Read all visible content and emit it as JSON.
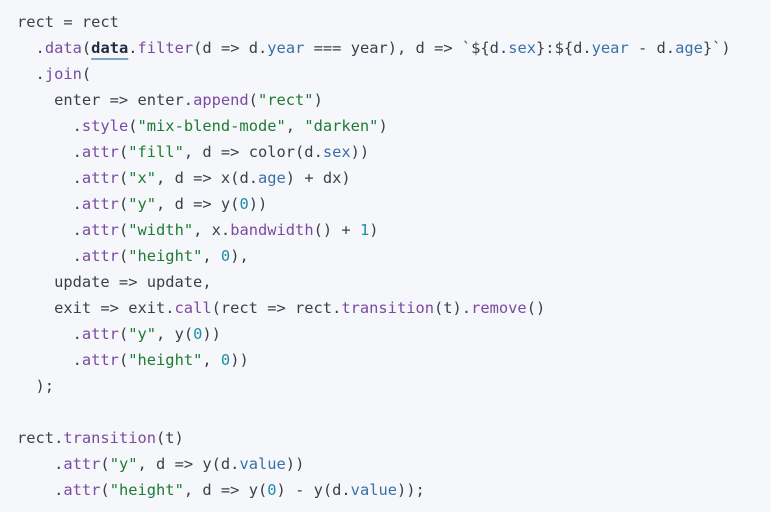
{
  "colors": {
    "background": "#f5f7fb",
    "plain": "#3b3f4a",
    "method": "#7a4ba0",
    "string": "#1f7a33",
    "number": "#1b8fa3",
    "property": "#3b6fa8"
  },
  "code": {
    "lines": [
      [
        {
          "t": "plain",
          "v": "rect = rect"
        }
      ],
      [
        {
          "t": "plain",
          "v": "  ."
        },
        {
          "t": "method",
          "v": "data"
        },
        {
          "t": "plain",
          "v": "("
        },
        {
          "t": "keyword-ref",
          "v": "data"
        },
        {
          "t": "plain",
          "v": "."
        },
        {
          "t": "method",
          "v": "filter"
        },
        {
          "t": "plain",
          "v": "(d => d."
        },
        {
          "t": "prop",
          "v": "year"
        },
        {
          "t": "plain",
          "v": " === year), d => `${d."
        },
        {
          "t": "prop",
          "v": "sex"
        },
        {
          "t": "plain",
          "v": "}:${d."
        },
        {
          "t": "prop",
          "v": "year"
        },
        {
          "t": "plain",
          "v": " - d."
        },
        {
          "t": "prop",
          "v": "age"
        },
        {
          "t": "plain",
          "v": "}`)"
        }
      ],
      [
        {
          "t": "plain",
          "v": "  ."
        },
        {
          "t": "method",
          "v": "join"
        },
        {
          "t": "plain",
          "v": "("
        }
      ],
      [
        {
          "t": "plain",
          "v": "    enter => enter."
        },
        {
          "t": "method",
          "v": "append"
        },
        {
          "t": "plain",
          "v": "("
        },
        {
          "t": "string",
          "v": "\"rect\""
        },
        {
          "t": "plain",
          "v": ")"
        }
      ],
      [
        {
          "t": "plain",
          "v": "      ."
        },
        {
          "t": "method",
          "v": "style"
        },
        {
          "t": "plain",
          "v": "("
        },
        {
          "t": "string",
          "v": "\"mix-blend-mode\""
        },
        {
          "t": "plain",
          "v": ", "
        },
        {
          "t": "string",
          "v": "\"darken\""
        },
        {
          "t": "plain",
          "v": ")"
        }
      ],
      [
        {
          "t": "plain",
          "v": "      ."
        },
        {
          "t": "method",
          "v": "attr"
        },
        {
          "t": "plain",
          "v": "("
        },
        {
          "t": "string",
          "v": "\"fill\""
        },
        {
          "t": "plain",
          "v": ", d => color(d."
        },
        {
          "t": "prop",
          "v": "sex"
        },
        {
          "t": "plain",
          "v": "))"
        }
      ],
      [
        {
          "t": "plain",
          "v": "      ."
        },
        {
          "t": "method",
          "v": "attr"
        },
        {
          "t": "plain",
          "v": "("
        },
        {
          "t": "string",
          "v": "\"x\""
        },
        {
          "t": "plain",
          "v": ", d => x(d."
        },
        {
          "t": "prop",
          "v": "age"
        },
        {
          "t": "plain",
          "v": ") + dx)"
        }
      ],
      [
        {
          "t": "plain",
          "v": "      ."
        },
        {
          "t": "method",
          "v": "attr"
        },
        {
          "t": "plain",
          "v": "("
        },
        {
          "t": "string",
          "v": "\"y\""
        },
        {
          "t": "plain",
          "v": ", d => y("
        },
        {
          "t": "number",
          "v": "0"
        },
        {
          "t": "plain",
          "v": "))"
        }
      ],
      [
        {
          "t": "plain",
          "v": "      ."
        },
        {
          "t": "method",
          "v": "attr"
        },
        {
          "t": "plain",
          "v": "("
        },
        {
          "t": "string",
          "v": "\"width\""
        },
        {
          "t": "plain",
          "v": ", x."
        },
        {
          "t": "method",
          "v": "bandwidth"
        },
        {
          "t": "plain",
          "v": "() + "
        },
        {
          "t": "number",
          "v": "1"
        },
        {
          "t": "plain",
          "v": ")"
        }
      ],
      [
        {
          "t": "plain",
          "v": "      ."
        },
        {
          "t": "method",
          "v": "attr"
        },
        {
          "t": "plain",
          "v": "("
        },
        {
          "t": "string",
          "v": "\"height\""
        },
        {
          "t": "plain",
          "v": ", "
        },
        {
          "t": "number",
          "v": "0"
        },
        {
          "t": "plain",
          "v": "),"
        }
      ],
      [
        {
          "t": "plain",
          "v": "    update => update,"
        }
      ],
      [
        {
          "t": "plain",
          "v": "    exit => exit."
        },
        {
          "t": "method",
          "v": "call"
        },
        {
          "t": "plain",
          "v": "(rect => rect."
        },
        {
          "t": "method",
          "v": "transition"
        },
        {
          "t": "plain",
          "v": "(t)."
        },
        {
          "t": "method",
          "v": "remove"
        },
        {
          "t": "plain",
          "v": "()"
        }
      ],
      [
        {
          "t": "plain",
          "v": "      ."
        },
        {
          "t": "method",
          "v": "attr"
        },
        {
          "t": "plain",
          "v": "("
        },
        {
          "t": "string",
          "v": "\"y\""
        },
        {
          "t": "plain",
          "v": ", y("
        },
        {
          "t": "number",
          "v": "0"
        },
        {
          "t": "plain",
          "v": "))"
        }
      ],
      [
        {
          "t": "plain",
          "v": "      ."
        },
        {
          "t": "method",
          "v": "attr"
        },
        {
          "t": "plain",
          "v": "("
        },
        {
          "t": "string",
          "v": "\"height\""
        },
        {
          "t": "plain",
          "v": ", "
        },
        {
          "t": "number",
          "v": "0"
        },
        {
          "t": "plain",
          "v": "))"
        }
      ],
      [
        {
          "t": "plain",
          "v": "  );"
        }
      ],
      [
        {
          "t": "plain",
          "v": ""
        }
      ],
      [
        {
          "t": "plain",
          "v": "rect."
        },
        {
          "t": "method",
          "v": "transition"
        },
        {
          "t": "plain",
          "v": "(t)"
        }
      ],
      [
        {
          "t": "plain",
          "v": "    ."
        },
        {
          "t": "method",
          "v": "attr"
        },
        {
          "t": "plain",
          "v": "("
        },
        {
          "t": "string",
          "v": "\"y\""
        },
        {
          "t": "plain",
          "v": ", d => y(d."
        },
        {
          "t": "prop",
          "v": "value"
        },
        {
          "t": "plain",
          "v": "))"
        }
      ],
      [
        {
          "t": "plain",
          "v": "    ."
        },
        {
          "t": "method",
          "v": "attr"
        },
        {
          "t": "plain",
          "v": "("
        },
        {
          "t": "string",
          "v": "\"height\""
        },
        {
          "t": "plain",
          "v": ", d => y("
        },
        {
          "t": "number",
          "v": "0"
        },
        {
          "t": "plain",
          "v": ") - y(d."
        },
        {
          "t": "prop",
          "v": "value"
        },
        {
          "t": "plain",
          "v": "));"
        }
      ]
    ]
  }
}
